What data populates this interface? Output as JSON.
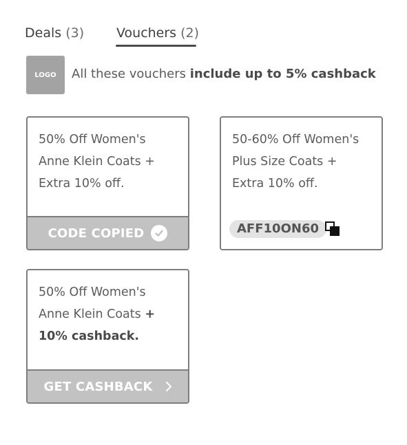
{
  "tabs": [
    {
      "label": "Deals",
      "count": "(3)"
    },
    {
      "label": "Vouchers",
      "count": "(2)"
    }
  ],
  "merchant": {
    "logo_text": "LOGO",
    "cashback_prefix": "All these vouchers",
    "cashback_bold": "include up to 5% cashback"
  },
  "cards": [
    {
      "line1": "50% Off Women's",
      "line2": "Anne Klein Coats +",
      "line3": "Extra 10% off.",
      "footer_label": "CODE COPIED"
    },
    {
      "line1": "50-60% Off Women's",
      "line2": "Plus Size Coats +",
      "line3": "Extra 10% off.",
      "code": "AFF10ON60"
    },
    {
      "line1": "50% Off Women's",
      "line2": "Anne Klein Coats",
      "line2_plus": "+",
      "line3": "10% cashback.",
      "footer_label": "GET CASHBACK"
    }
  ],
  "colors": {
    "footer_bg": "#c2c2c2",
    "border": "#7d7d7d",
    "logo_bg": "#a3a3a3",
    "code_pill_bg": "#e3e3e3"
  },
  "icons": [
    "check-icon",
    "copy-icon",
    "chevron-right-icon"
  ]
}
